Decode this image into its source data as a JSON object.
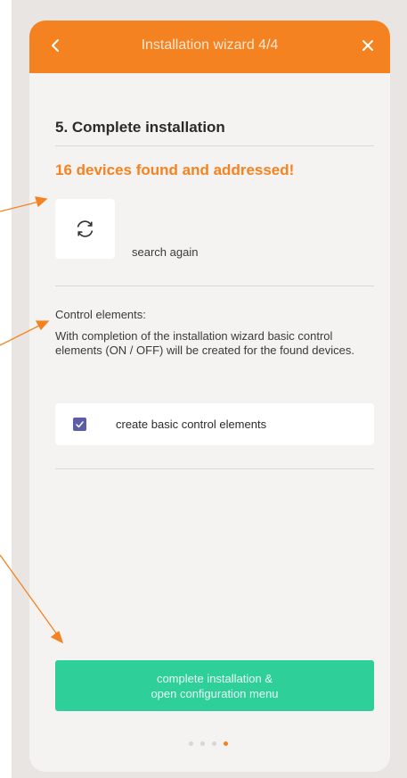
{
  "header": {
    "title": "Installation wizard 4/4",
    "back_icon": "chevron-left-icon",
    "close_icon": "close-icon",
    "color": "#f58220"
  },
  "main": {
    "section_title": "5. Complete installation",
    "found_text": "16 devices found and addressed!",
    "search_icon": "refresh-icon",
    "search_label": "search again",
    "control_heading": "Control elements:",
    "control_description": "With completion of the installation wizard basic control elements (ON / OFF) will be created for the found devices.",
    "checkbox_label": "create basic control elements",
    "checkbox_checked": true,
    "primary_line1": "complete installation &",
    "primary_line2": "open configuration menu",
    "primary_color": "#2ecf98"
  },
  "pagination": {
    "total": 4,
    "current": 4
  }
}
